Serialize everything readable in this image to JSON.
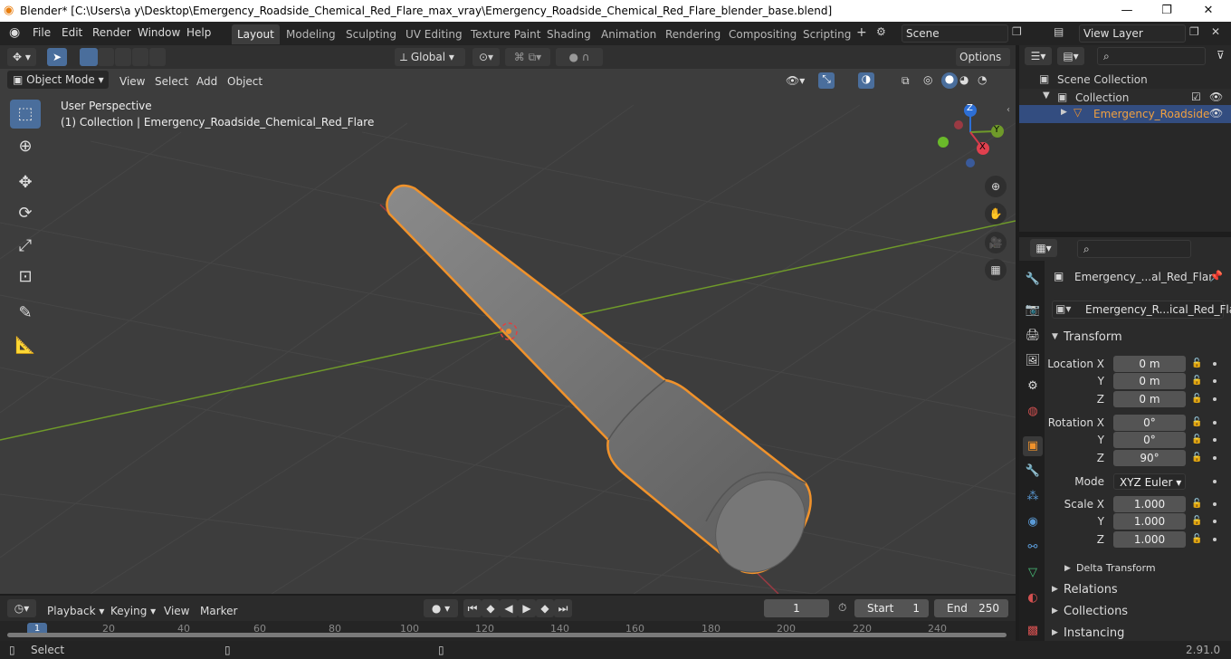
{
  "window": {
    "title": "Blender* [C:\\Users\\a y\\Desktop\\Emergency_Roadside_Chemical_Red_Flare_max_vray\\Emergency_Roadside_Chemical_Red_Flare_blender_base.blend]",
    "min": "—",
    "max": "❐",
    "close": "✕"
  },
  "menus": [
    "File",
    "Edit",
    "Render",
    "Window",
    "Help"
  ],
  "workspaces": [
    "Layout",
    "Modeling",
    "Sculpting",
    "UV Editing",
    "Texture Paint",
    "Shading",
    "Animation",
    "Rendering",
    "Compositing",
    "Scripting"
  ],
  "scene": "Scene",
  "view_layer": "View Layer",
  "viewport": {
    "mode": "Object Mode",
    "menus": [
      "View",
      "Select",
      "Add",
      "Object"
    ],
    "orientation": "Global",
    "options": "Options",
    "perspective": "User Perspective",
    "collection_info": "(1) Collection | Emergency_Roadside_Chemical_Red_Flare"
  },
  "gizmo": {
    "x": "X",
    "y": "Y",
    "z": "Z"
  },
  "outliner": {
    "scene_collection": "Scene Collection",
    "collection": "Collection",
    "object": "Emergency_Roadside"
  },
  "properties": {
    "object_name": "Emergency_...al_Red_Flar",
    "data_name": "Emergency_R...ical_Red_Flare",
    "transform": "Transform",
    "location": {
      "label_x": "Location X",
      "label_y": "Y",
      "label_z": "Z",
      "x": "0 m",
      "y": "0 m",
      "z": "0 m"
    },
    "rotation": {
      "label_x": "Rotation X",
      "label_y": "Y",
      "label_z": "Z",
      "x": "0°",
      "y": "0°",
      "z": "90°"
    },
    "mode_label": "Mode",
    "mode": "XYZ Euler",
    "scale": {
      "label_x": "Scale X",
      "label_y": "Y",
      "label_z": "Z",
      "x": "1.000",
      "y": "1.000",
      "z": "1.000"
    },
    "delta": "Delta Transform",
    "relations": "Relations",
    "collections": "Collections",
    "instancing": "Instancing"
  },
  "timeline": {
    "menus": [
      "Playback",
      "Keying",
      "View",
      "Marker"
    ],
    "current_frame": "1",
    "start_label": "Start",
    "start": "1",
    "end_label": "End",
    "end": "250",
    "ruler": [
      "1",
      "20",
      "40",
      "60",
      "80",
      "100",
      "120",
      "140",
      "160",
      "180",
      "200",
      "220",
      "240"
    ]
  },
  "status": {
    "select": "Select",
    "version": "2.91.0"
  },
  "colors": {
    "accent": "#4a6e9c",
    "selection_outline": "#f0922b",
    "x_axis": "#9a3a43",
    "y_axis": "#6f9a2a"
  }
}
